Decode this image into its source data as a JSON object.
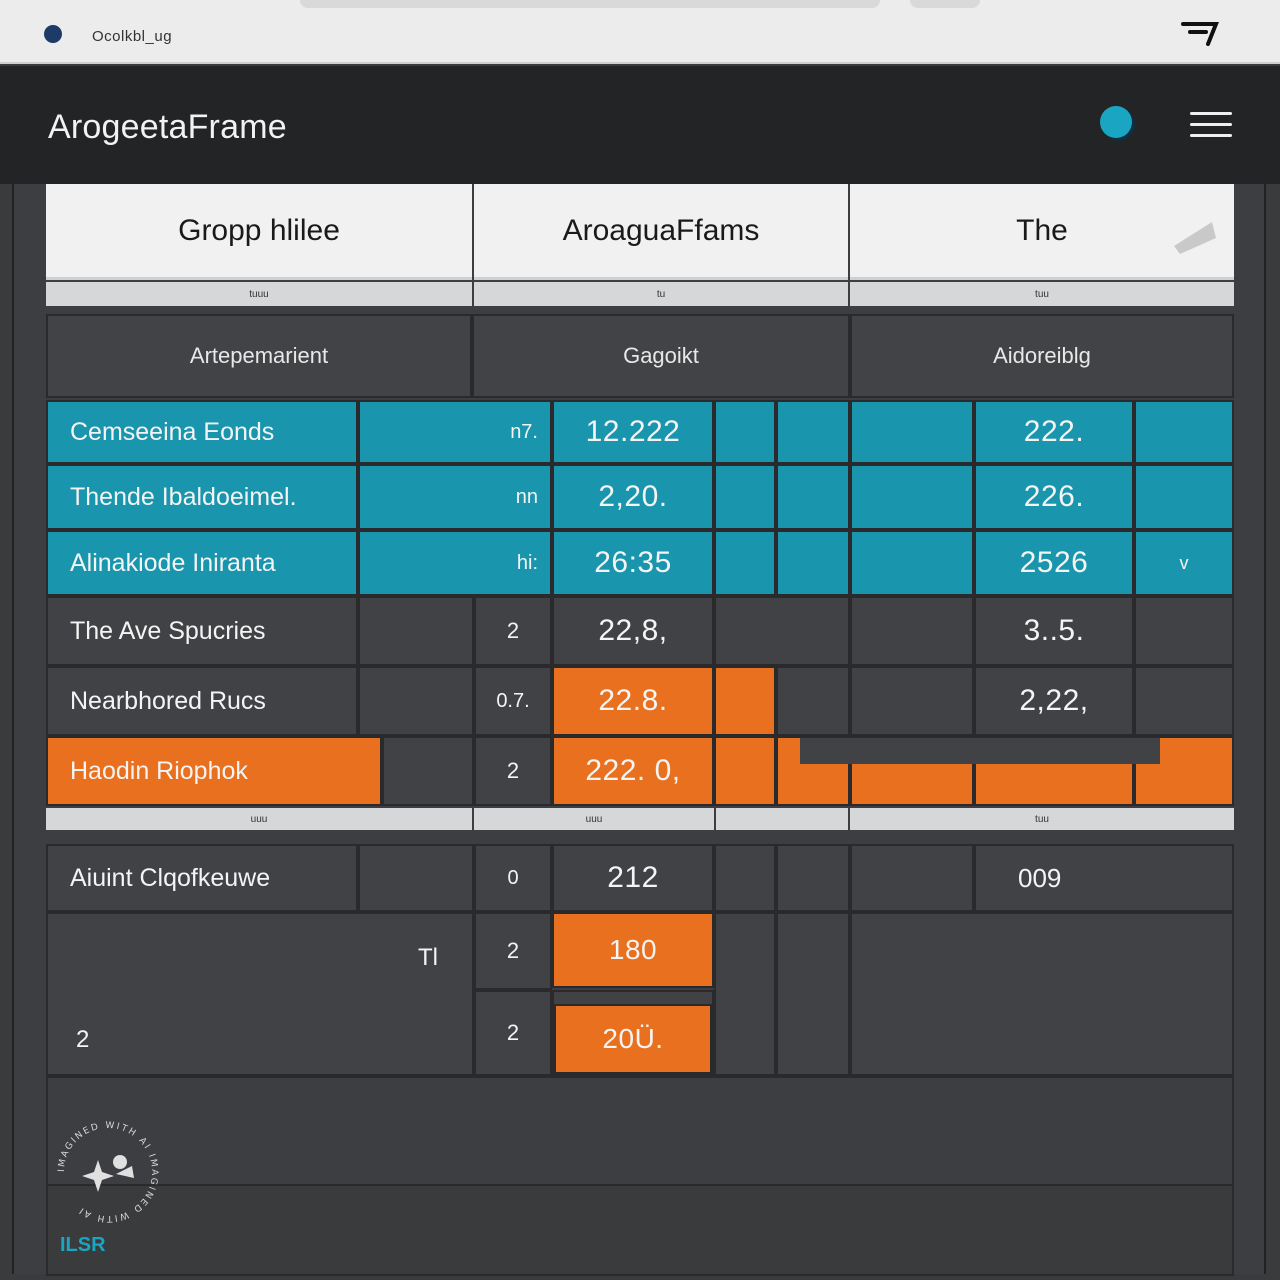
{
  "browser": {
    "url_text": "Ocolkbl_ug",
    "ext_icon": "ext-icon"
  },
  "app": {
    "title": "ArogeetaFrame",
    "status_color": "#1aa6c2"
  },
  "columns": [
    {
      "title": "Gropp hlilee",
      "sub": "tuuu"
    },
    {
      "title": "AroaguaFfams",
      "sub": "tu"
    },
    {
      "title": "The",
      "sub": "tuu"
    }
  ],
  "sections": [
    {
      "title": "Artepemarient"
    },
    {
      "title": "Gagoikt"
    },
    {
      "title": "Aidoreiblg"
    }
  ],
  "rows": [
    {
      "label": "Cemseeina Eonds",
      "count": "n7.",
      "value": "12.222",
      "value2": "222."
    },
    {
      "label": "Thende Ibaldoeimel.",
      "count": "nn",
      "value": "2,20.",
      "value2": "226."
    },
    {
      "label": "Alinakiode Iniranta",
      "count": "hi:",
      "value": "26:35",
      "value2": "2526",
      "value3": "v"
    },
    {
      "label": "The Ave Spucries",
      "count": "2",
      "value": "22,8,",
      "value2": "3..5."
    },
    {
      "label": "Nearbhored Rucs",
      "count": "0.7.",
      "value": "22.8.",
      "value2": "2,22,"
    },
    {
      "label": "Haodin Riophok",
      "count": "2",
      "value": "222. 0,"
    }
  ],
  "lower_subheads": [
    "uuu",
    "uuu",
    "tuu"
  ],
  "lower_rows": [
    {
      "label": "Aiuint Clqofkeuwe",
      "count": "0",
      "value": "212",
      "value2": "009"
    },
    {
      "label": "Tl",
      "count": "2",
      "value": "180"
    },
    {
      "label": "2",
      "count": "2",
      "value": "20Ü."
    }
  ],
  "watermark": {
    "ring_text": "IMAGINED WITH AI IMAGINED WITH AI",
    "logo": "ILSR"
  }
}
